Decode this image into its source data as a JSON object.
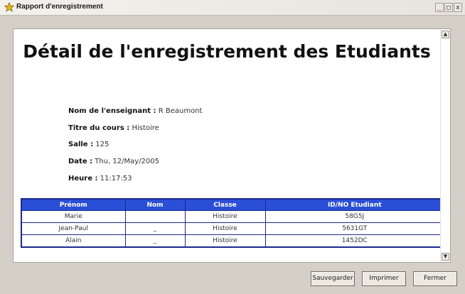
{
  "window": {
    "title": "Rapport d'enregistrement",
    "controls": {
      "minimize": "_",
      "maximize": "□",
      "close": "x"
    }
  },
  "report": {
    "title": "Détail de l'enregistrement des Etudiants",
    "fields": [
      {
        "label": "Nom de l'enseignant :",
        "value": "R Beaumont"
      },
      {
        "label": "Titre du cours :",
        "value": "Histoire"
      },
      {
        "label": "Salle :",
        "value": "125"
      },
      {
        "label": "Date :",
        "value": "Thu, 12/May/2005"
      },
      {
        "label": "Heure :",
        "value": "11:17:53"
      }
    ],
    "table": {
      "headers": [
        "Prénom",
        "Nom",
        "Classe",
        "ID/NO Etudiant"
      ],
      "rows": [
        [
          "Marie",
          "",
          "Histoire",
          "58G5J"
        ],
        [
          "Jean-Paul",
          "_",
          "Histoire",
          "5631GT"
        ],
        [
          "Alain",
          "_",
          "Histoire",
          "1452DC"
        ]
      ]
    }
  },
  "buttons": {
    "save": "Sauvegarder",
    "print": "Imprimer",
    "close": "Fermer"
  },
  "colors": {
    "table_header_bg": "#2a4fd6",
    "table_border": "#1b2a8c"
  },
  "icons": {
    "app": "star-icon",
    "scroll_up": "scroll-up-arrow-icon",
    "scroll_down": "scroll-down-arrow-icon"
  }
}
